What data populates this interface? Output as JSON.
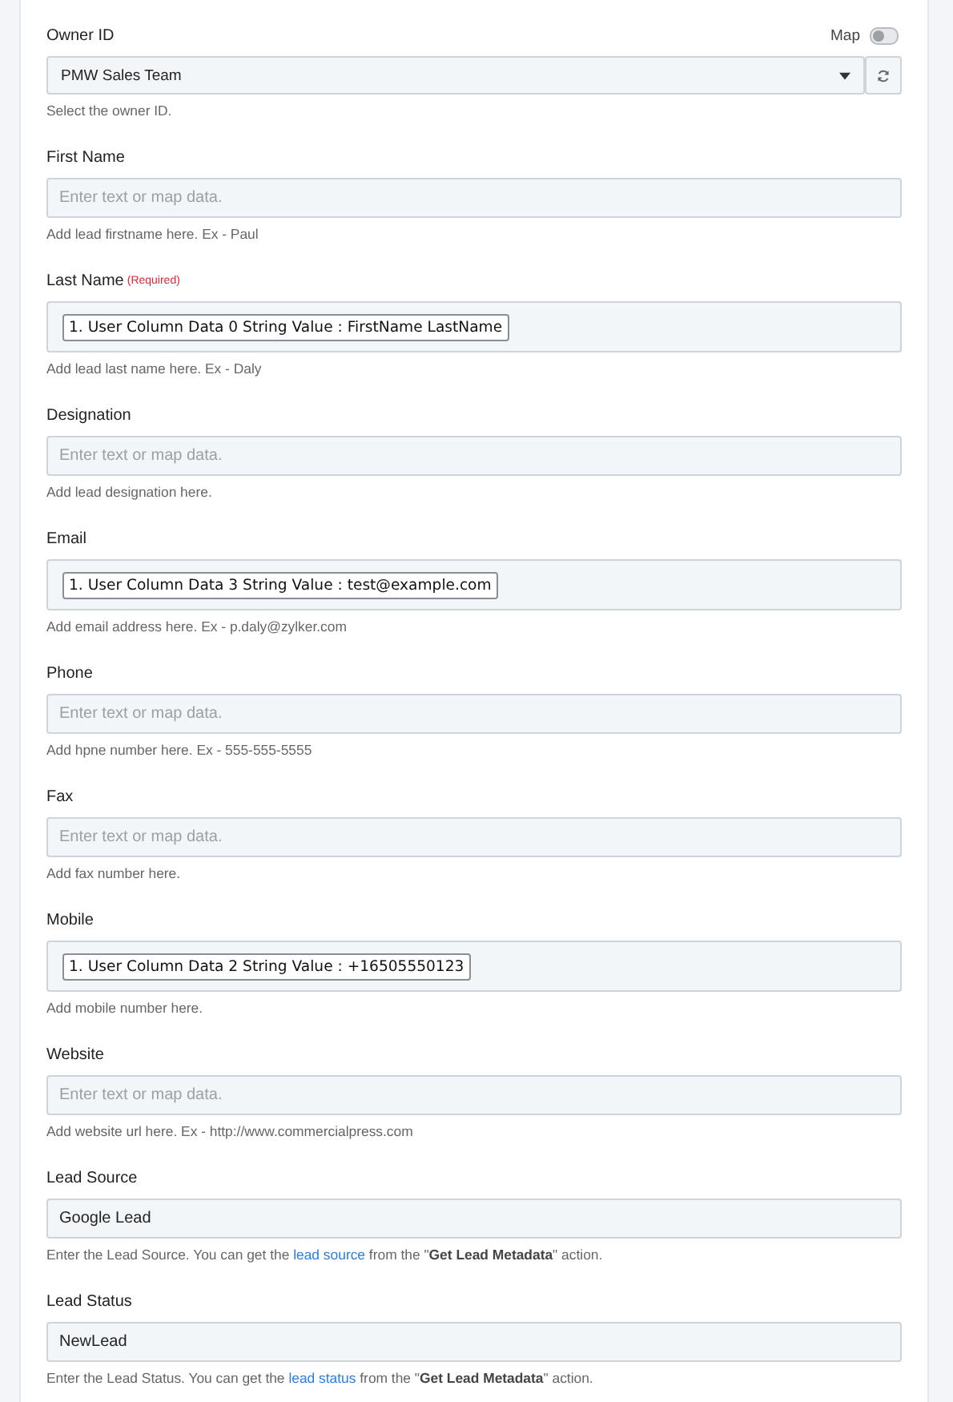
{
  "fields": [
    {
      "kind": "select",
      "label": "Owner ID",
      "map": {
        "label": "Map",
        "on": false
      },
      "value": "PMW Sales Team",
      "help": {
        "text": "Select the owner ID."
      }
    },
    {
      "kind": "text",
      "label": "First Name",
      "placeholder": "Enter text or map data.",
      "help": {
        "text": "Add lead firstname here. Ex - Paul"
      }
    },
    {
      "kind": "mapped",
      "label": "Last Name",
      "required": "(Required)",
      "chip": "1. User Column Data 0 String Value : FirstName LastName",
      "help": {
        "text": "Add lead last name here. Ex - Daly"
      }
    },
    {
      "kind": "text",
      "label": "Designation",
      "placeholder": "Enter text or map data.",
      "help": {
        "text": "Add lead designation here."
      }
    },
    {
      "kind": "mapped",
      "label": "Email",
      "chip": "1. User Column Data 3 String Value : test@example.com",
      "help": {
        "text": "Add email address here. Ex - p.daly@zylker.com"
      }
    },
    {
      "kind": "text",
      "label": "Phone",
      "placeholder": "Enter text or map data.",
      "help": {
        "text": "Add hpne number here. Ex - 555-555-5555"
      }
    },
    {
      "kind": "text",
      "label": "Fax",
      "placeholder": "Enter text or map data.",
      "help": {
        "text": "Add fax number here."
      }
    },
    {
      "kind": "mapped",
      "label": "Mobile",
      "chip": "1. User Column Data 2 String Value : +16505550123",
      "help": {
        "text": "Add mobile number here."
      }
    },
    {
      "kind": "text",
      "label": "Website",
      "placeholder": "Enter text or map data.",
      "help": {
        "text": "Add website url here. Ex - http://www.commercialpress.com"
      }
    },
    {
      "kind": "text",
      "label": "Lead Source",
      "value": "Google Lead",
      "help": {
        "text": "Enter the Lead Source. You can get the ",
        "link": "lead source",
        "after": " from the \"**Get Lead Metadata**\" action."
      }
    },
    {
      "kind": "text",
      "label": "Lead Status",
      "value": "NewLead",
      "help": {
        "text": "Enter the Lead Status. You can get the ",
        "link": "lead status",
        "after": " from the \"**Get Lead Metadata**\" action."
      }
    }
  ]
}
